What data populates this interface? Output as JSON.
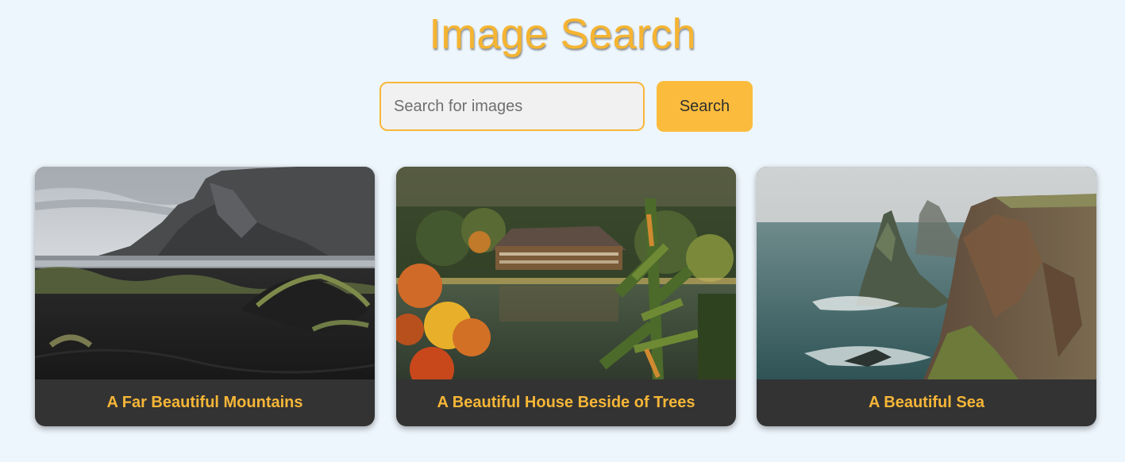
{
  "header": {
    "title": "Image Search"
  },
  "search": {
    "placeholder": "Search for images",
    "value": "",
    "button_label": "Search"
  },
  "results": [
    {
      "caption": "A Far Beautiful Mountains",
      "scene": "black sand beach with mountains"
    },
    {
      "caption": "A Beautiful House Beside of Trees",
      "scene": "lodge beside lake with autumn foliage"
    },
    {
      "caption": "A Beautiful Sea",
      "scene": "sea stacks and cliffs"
    }
  ],
  "colors": {
    "accent": "#f5b431",
    "background": "#eef6fd",
    "card": "#333333"
  }
}
